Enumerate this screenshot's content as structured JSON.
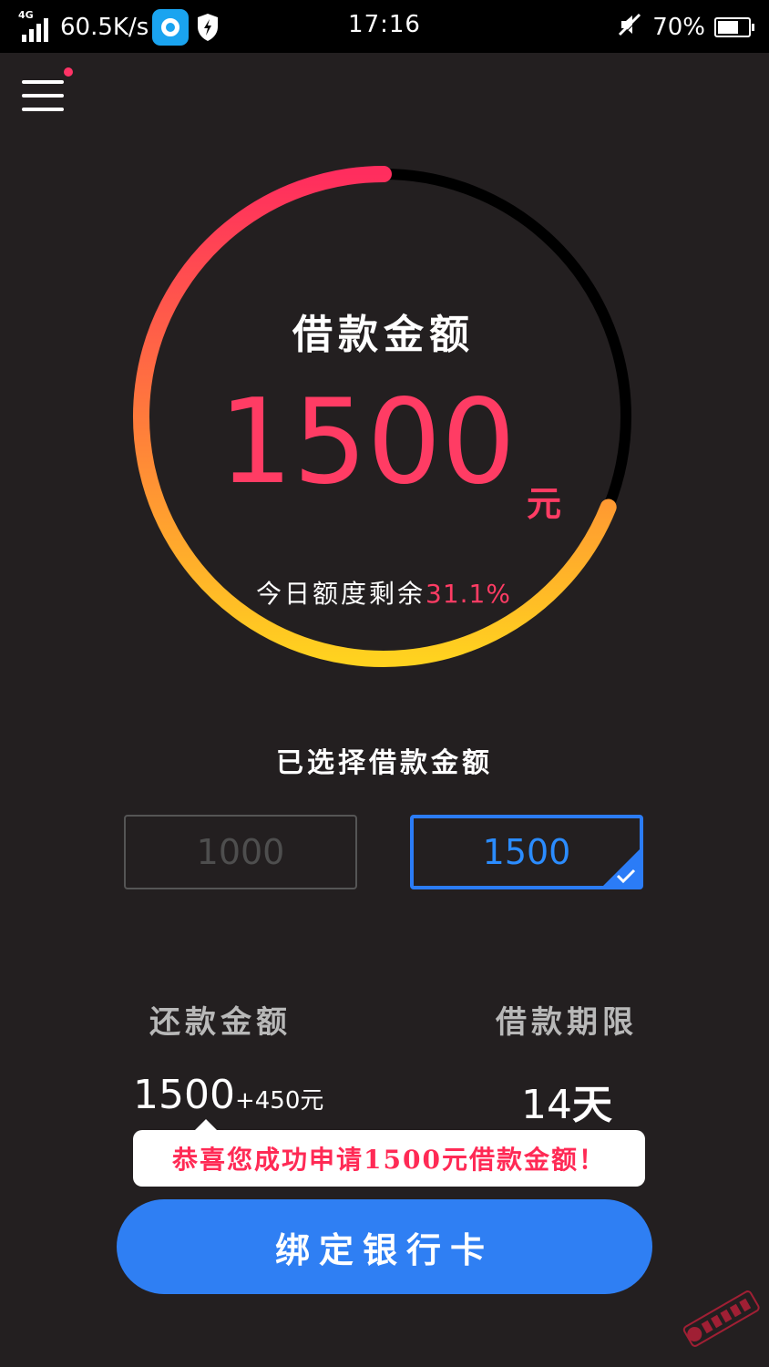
{
  "status_bar": {
    "network": "4G",
    "speed": "60.5K/s",
    "time": "17:16",
    "battery": "70%",
    "battery_level": 0.7,
    "icons": [
      "signal-icon",
      "app-icon",
      "shield-icon",
      "mute-icon",
      "battery-icon"
    ]
  },
  "header": {
    "menu_icon": "menu-icon",
    "notification_dot_color": "#ff3366"
  },
  "gauge": {
    "title": "借款金额",
    "amount": "1500",
    "unit": "元",
    "remaining_label": "今日额度剩余",
    "remaining_value": "31.1%",
    "progress_fraction": 0.689,
    "colors": {
      "start": "#ff2d5e",
      "mid": "#ff7a3c",
      "end": "#ffd21f",
      "track": "#000000",
      "accent": "#ff3c64"
    }
  },
  "selection": {
    "title": "已选择借款金额",
    "options": [
      {
        "label": "1000",
        "selected": false
      },
      {
        "label": "1500",
        "selected": true
      }
    ],
    "selected_color": "#2b7cf7"
  },
  "summary": {
    "repay_label": "还款金额",
    "repay_amount": "1500",
    "repay_fee": "+450",
    "repay_unit": "元",
    "term_label": "借款期限",
    "term_value": "14",
    "term_unit": "天"
  },
  "toast": {
    "message": "恭喜您成功申请1500元借款金额！"
  },
  "actions": {
    "bind_card": "绑定银行卡",
    "button_color": "#2f7ff3"
  }
}
